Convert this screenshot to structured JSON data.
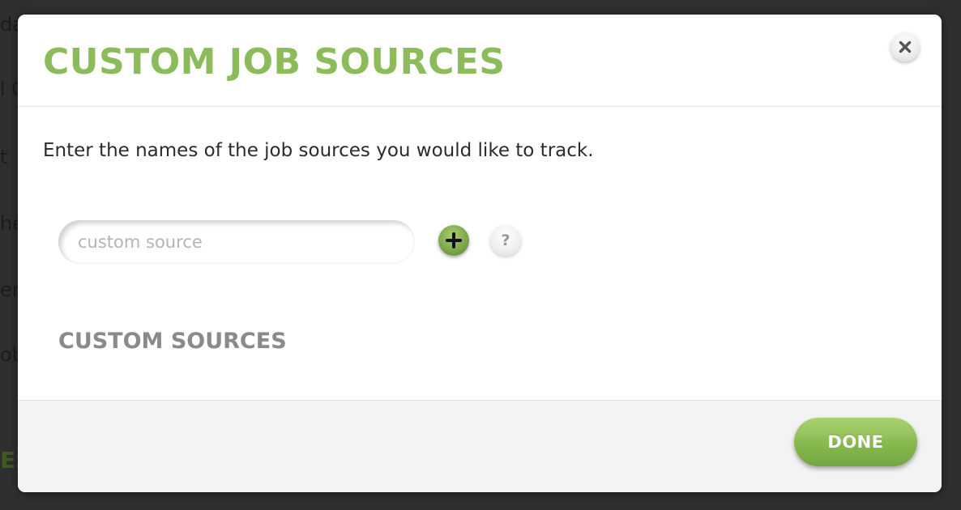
{
  "background": {
    "fragments": [
      "da",
      "l C",
      "t",
      "he",
      "en",
      "ob",
      "ES"
    ]
  },
  "modal": {
    "title": "CUSTOM JOB SOURCES",
    "close_icon": "close-icon",
    "intro": "Enter the names of the job sources you would like to track.",
    "input": {
      "value": "",
      "placeholder": "custom source"
    },
    "add_icon": "plus-icon",
    "help_label": "?",
    "section_heading": "CUSTOM SOURCES",
    "custom_sources": [],
    "done_label": "DONE"
  },
  "colors": {
    "accent_green": "#8cbc5a",
    "button_green": "#8abb52",
    "heading_gray": "#8a8a8a",
    "overlay": "#2f2f2f"
  }
}
